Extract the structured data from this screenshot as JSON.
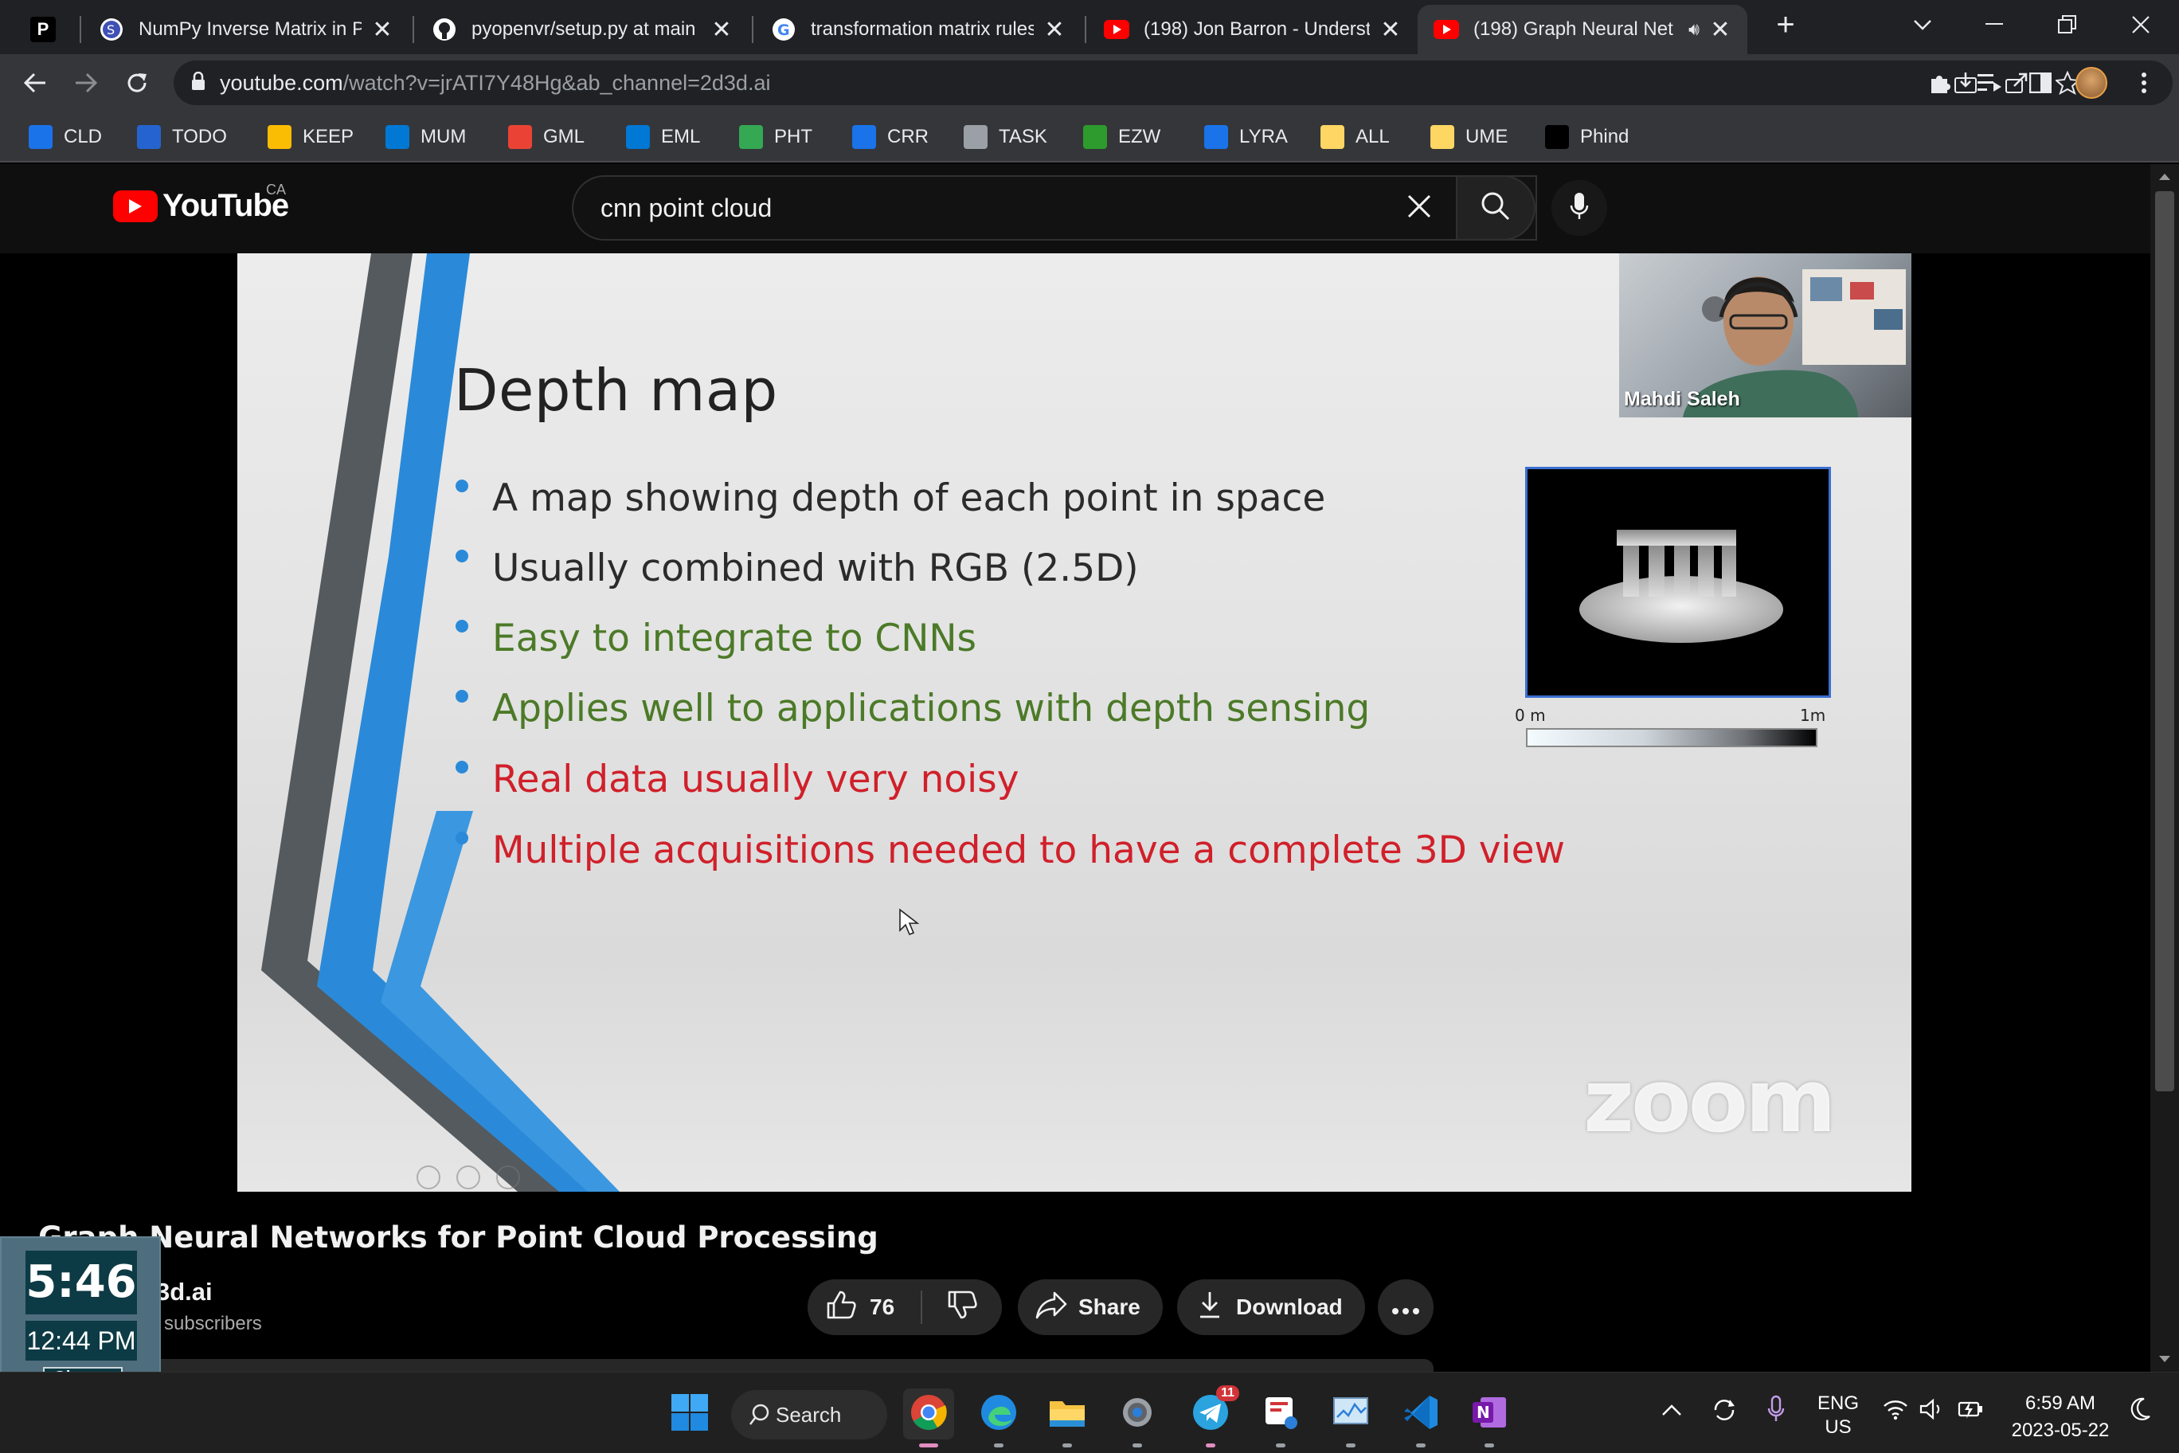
{
  "browser": {
    "tabs": [
      {
        "title": ""
      },
      {
        "title": "NumPy Inverse Matrix in Py"
      },
      {
        "title": "pyopenvr/setup.py at main"
      },
      {
        "title": "transformation matrix rules"
      },
      {
        "title": "(198) Jon Barron - Understa"
      },
      {
        "title": "(198) Graph Neural Net"
      }
    ],
    "new_tab": "+",
    "url": {
      "host": "youtube.com",
      "path": "/watch?v=jrATI7Y48Hg&ab_channel=2d3d.ai"
    },
    "bookmarks": [
      {
        "label": "CLD",
        "icon": "calendar-icon",
        "color": "#1a73e8"
      },
      {
        "label": "TODO",
        "icon": "todo-icon",
        "color": "#2564cf"
      },
      {
        "label": "KEEP",
        "icon": "keep-icon",
        "color": "#fbbc04"
      },
      {
        "label": "MUM",
        "icon": "outlook-icon",
        "color": "#0078d4"
      },
      {
        "label": "GML",
        "icon": "gmail-icon",
        "color": "#ea4335"
      },
      {
        "label": "EML",
        "icon": "email-icon",
        "color": "#0078d4"
      },
      {
        "label": "PHT",
        "icon": "photos-icon",
        "color": "#34a853"
      },
      {
        "label": "CRR",
        "icon": "sync-icon",
        "color": "#1a73e8"
      },
      {
        "label": "TASK",
        "icon": "task-icon",
        "color": "#9aa0a6"
      },
      {
        "label": "EZW",
        "icon": "td-icon",
        "color": "#2d9b2d"
      },
      {
        "label": "LYRA",
        "icon": "lyra-icon",
        "color": "#1a73e8"
      },
      {
        "label": "ALL",
        "icon": "folder-icon",
        "color": "#fdd663"
      },
      {
        "label": "UME",
        "icon": "folder-icon",
        "color": "#fdd663"
      },
      {
        "label": "Phind",
        "icon": "phind-icon",
        "color": "#000000"
      }
    ]
  },
  "youtube": {
    "logo_text": "YouTube",
    "country_code": "CA",
    "search_query": "cnn point cloud"
  },
  "slide": {
    "title": "Depth map",
    "bullets": [
      {
        "text": "A map showing depth of each point in space",
        "color": "#2b2b2b"
      },
      {
        "text": "Usually combined with RGB (2.5D)",
        "color": "#2b2b2b"
      },
      {
        "text": "Easy to integrate to CNNs",
        "color": "#4c7a28"
      },
      {
        "text": "Applies well to applications with depth sensing",
        "color": "#4c7a28"
      },
      {
        "text": "Real data usually very noisy",
        "color": "#d0202a"
      },
      {
        "text": "Multiple acquisitions needed to have a complete 3D view",
        "color": "#d0202a"
      }
    ],
    "scale_min": "0 m",
    "scale_max": "1m",
    "webcam_name": "Mahdi Saleh",
    "watermark": "zoom"
  },
  "video": {
    "title": "Graph Neural Networks for Point Cloud Processing",
    "channel": "3d.ai",
    "subscribers": "subscribers",
    "likes": "76",
    "share": "Share",
    "download": "Download"
  },
  "timer_widget": {
    "countdown": "5:46",
    "time": "12:44 PM",
    "give_up": "Give up"
  },
  "taskbar": {
    "search": "Search",
    "telegram_badge": "11",
    "lang": "ENG",
    "region": "US",
    "time": "6:59 AM",
    "date": "2023-05-22"
  }
}
